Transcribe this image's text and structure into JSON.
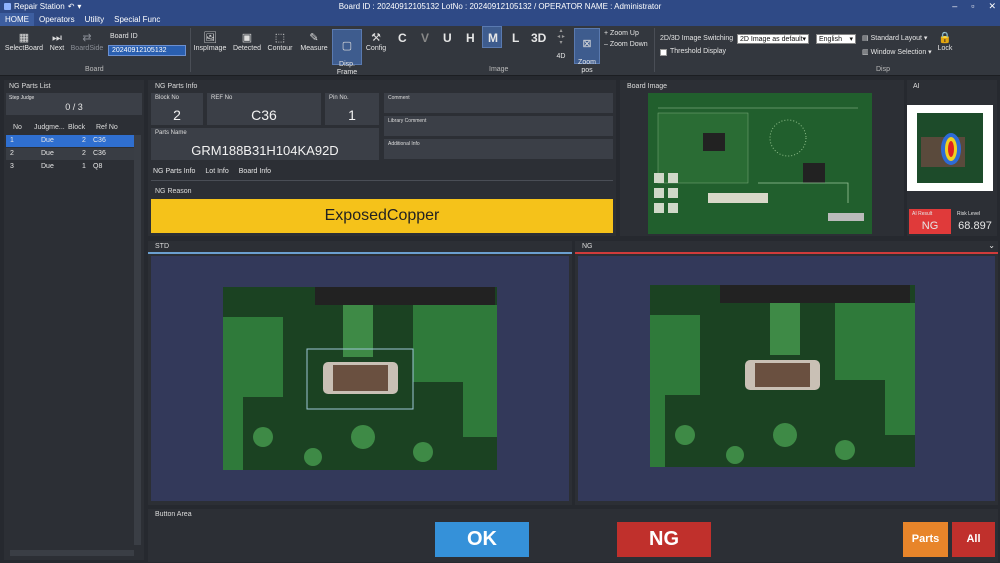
{
  "window": {
    "app_title": "Repair Station",
    "title": "Board ID : 20240912105132 LotNo : 20240912105132 / OPERATOR NAME : Administrator"
  },
  "menu": [
    "HOME",
    "Operators",
    "Utility",
    "Special Func"
  ],
  "ribbon": {
    "select_board": "SelectBoard",
    "next": "Next",
    "board_side": "BoardSide",
    "board_id_label": "Board ID",
    "board_id_value": "20240912105132",
    "board_group": "Board",
    "insp_image": "InspImage",
    "detected": "Detected",
    "contour": "Contour",
    "measure": "Measure",
    "disp_frame": "Disp.\nFrame",
    "config": "Config",
    "letters": [
      "C",
      "V",
      "U",
      "H",
      "M",
      "L",
      "3D"
    ],
    "four_d": "4D",
    "zoom_pos": "Zoom\npos",
    "zoom_up": "Zoom Up",
    "zoom_down": "Zoom Down",
    "image_group": "Image",
    "switch_label": "2D/3D Image Switching",
    "switch_value": "2D Image as default",
    "threshold": "Threshold Display",
    "language": "English",
    "standard_layout": "Standard Layout",
    "window_selection": "Window Selection",
    "lock": "Lock",
    "disp_group": "Disp"
  },
  "ng_list": {
    "title": "NG Parts List",
    "step_judge_label": "Step Judge",
    "step_judge_value": "0 / 3",
    "headers": [
      "No",
      "Judgme...",
      "Block",
      "Ref No"
    ],
    "rows": [
      {
        "no": "1",
        "judge": "Due",
        "block": "2",
        "ref": "C36"
      },
      {
        "no": "2",
        "judge": "Due",
        "block": "2",
        "ref": "C36"
      },
      {
        "no": "3",
        "judge": "Due",
        "block": "1",
        "ref": "Q8"
      }
    ]
  },
  "info": {
    "title": "NG Parts Info",
    "block_label": "Block No",
    "block_value": "2",
    "ref_label": "REF No",
    "ref_value": "C36",
    "pin_label": "Pin No.",
    "pin_value": "1",
    "parts_label": "Parts Name",
    "parts_value": "GRM188B31H104KA92D",
    "comment": "Comment",
    "library_comment": "Library Comment",
    "additional_info": "Additional Info",
    "tabs": [
      "NG Parts Info",
      "Lot Info",
      "Board Info"
    ],
    "reason_label": "NG Reason",
    "reason_value": "ExposedCopper"
  },
  "board_image": {
    "title": "Board Image"
  },
  "ai": {
    "title": "AI",
    "result_label": "AI Result",
    "result_value": "NG",
    "risk_label": "Risk Level",
    "risk_value": "68.897"
  },
  "std": {
    "title": "STD"
  },
  "ng": {
    "title": "NG"
  },
  "buttons": {
    "area_label": "Button Area",
    "ok": "OK",
    "ng": "NG",
    "parts": "Parts",
    "all": "All"
  },
  "colors": {
    "accent": "#3d5ea0",
    "ng_red": "#c0302c",
    "ok_blue": "#3591d9",
    "reason_yellow": "#f5c21a",
    "parts_orange": "#e8852a"
  }
}
